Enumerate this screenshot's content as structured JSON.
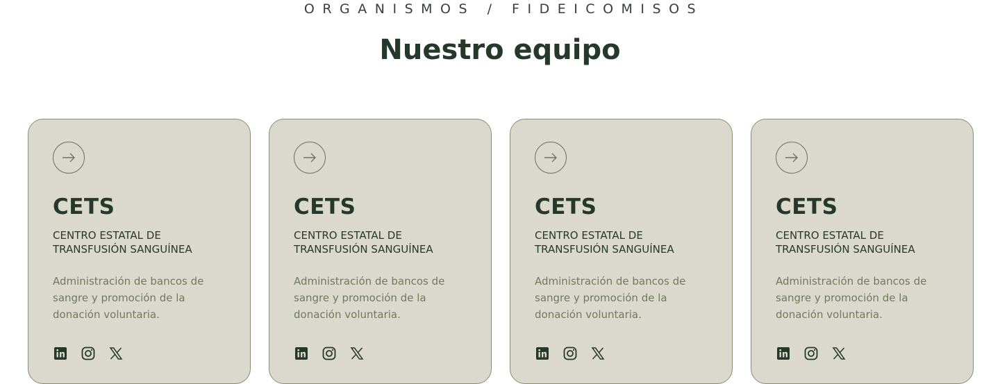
{
  "section": {
    "eyebrow": "ORGANISMOS / FIDEICOMISOS",
    "title": "Nuestro equipo"
  },
  "cards": [
    {
      "title": "CETS",
      "subtitle": "CENTRO ESTATAL DE TRANSFUSIÓN SANGUÍNEA",
      "description": "Administración de bancos de sangre y promoción de la donación voluntaria.",
      "icons": [
        "arrow-right-icon",
        "linkedin-icon",
        "instagram-icon",
        "x-icon"
      ]
    },
    {
      "title": "CETS",
      "subtitle": "CENTRO ESTATAL DE TRANSFUSIÓN SANGUÍNEA",
      "description": "Administración de bancos de sangre y promoción de la donación voluntaria.",
      "icons": [
        "arrow-right-icon",
        "linkedin-icon",
        "instagram-icon",
        "x-icon"
      ]
    },
    {
      "title": "CETS",
      "subtitle": "CENTRO ESTATAL DE TRANSFUSIÓN SANGUÍNEA",
      "description": "Administración de bancos de sangre y promoción de la donación voluntaria.",
      "icons": [
        "arrow-right-icon",
        "linkedin-icon",
        "instagram-icon",
        "x-icon"
      ]
    },
    {
      "title": "CETS",
      "subtitle": "CENTRO ESTATAL DE TRANSFUSIÓN SANGUÍNEA",
      "description": "Administración de bancos de sangre y promoción de la donación voluntaria.",
      "icons": [
        "arrow-right-icon",
        "linkedin-icon",
        "instagram-icon",
        "x-icon"
      ]
    }
  ],
  "colors": {
    "heading": "#25392a",
    "card_background": "#dbd9cd",
    "card_border": "#8a8b73",
    "description_text": "#707a5b"
  }
}
